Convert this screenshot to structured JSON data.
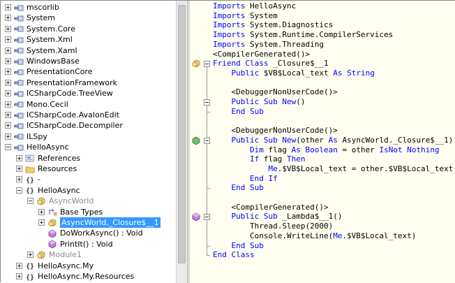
{
  "tree": {
    "items": [
      {
        "label": "mscorlib",
        "toggle": "plus",
        "icon": "assembly-icon"
      },
      {
        "label": "System",
        "toggle": "plus",
        "icon": "assembly-icon"
      },
      {
        "label": "System.Core",
        "toggle": "plus",
        "icon": "assembly-icon"
      },
      {
        "label": "System.Xml",
        "toggle": "plus",
        "icon": "assembly-icon"
      },
      {
        "label": "System.Xaml",
        "toggle": "plus",
        "icon": "assembly-icon"
      },
      {
        "label": "WindowsBase",
        "toggle": "plus",
        "icon": "assembly-icon"
      },
      {
        "label": "PresentationCore",
        "toggle": "plus",
        "icon": "assembly-icon"
      },
      {
        "label": "PresentationFramework",
        "toggle": "plus",
        "icon": "assembly-icon"
      },
      {
        "label": "ICSharpCode.TreeView",
        "toggle": "plus",
        "icon": "assembly-icon"
      },
      {
        "label": "Mono.Cecil",
        "toggle": "plus",
        "icon": "assembly-icon"
      },
      {
        "label": "ICSharpCode.AvalonEdit",
        "toggle": "plus",
        "icon": "assembly-icon"
      },
      {
        "label": "ICSharpCode.Decompiler",
        "toggle": "plus",
        "icon": "assembly-icon"
      },
      {
        "label": "ILSpy",
        "toggle": "plus",
        "icon": "assembly-icon"
      },
      {
        "label": "HelloAsync",
        "toggle": "minus",
        "icon": "assembly-icon"
      },
      {
        "label": "References",
        "toggle": "plus",
        "icon": "references-icon"
      },
      {
        "label": "Resources",
        "toggle": "plus",
        "icon": "folder-icon"
      },
      {
        "label": "-",
        "toggle": "plus",
        "icon": "namespace-icon"
      },
      {
        "label": "HelloAsync",
        "toggle": "minus",
        "icon": "namespace-icon"
      },
      {
        "label": "AsyncWorld",
        "toggle": "minus",
        "icon": "class-icon",
        "gray": true
      },
      {
        "label": "Base Types",
        "toggle": "plus",
        "icon": "base-types-icon"
      },
      {
        "label": "AsyncWorld._Closure$__1",
        "toggle": "plus",
        "icon": "class-icon",
        "selected": true
      },
      {
        "label": "DoWorkAsync() : Void",
        "toggle": "none",
        "icon": "method-icon"
      },
      {
        "label": "PrintIt() : Void",
        "toggle": "none",
        "icon": "method-icon"
      },
      {
        "label": "Module1",
        "toggle": "plus",
        "icon": "class-icon",
        "gray": true
      },
      {
        "label": "HelloAsync.My",
        "toggle": "plus",
        "icon": "namespace-icon"
      },
      {
        "label": "HelloAsync.My.Resources",
        "toggle": "plus",
        "icon": "namespace-icon"
      }
    ]
  },
  "code": {
    "lines": [
      [
        {
          "t": "Imports",
          "k": 1
        },
        {
          "t": " HelloAsync"
        }
      ],
      [
        {
          "t": "Imports",
          "k": 1
        },
        {
          "t": " System"
        }
      ],
      [
        {
          "t": "Imports",
          "k": 1
        },
        {
          "t": " System.Diagnostics"
        }
      ],
      [
        {
          "t": "Imports",
          "k": 1
        },
        {
          "t": " System.Runtime.CompilerServices"
        }
      ],
      [
        {
          "t": "Imports",
          "k": 1
        },
        {
          "t": " System.Threading"
        }
      ],
      [
        {
          "t": "<CompilerGenerated()>"
        }
      ],
      [
        {
          "t": "Friend",
          "k": 1
        },
        {
          "t": " "
        },
        {
          "t": "Class",
          "k": 1
        },
        {
          "t": " _Closure$__1"
        }
      ],
      [
        {
          "t": "    "
        },
        {
          "t": "Public",
          "k": 1
        },
        {
          "t": " $VB$Local_text "
        },
        {
          "t": "As",
          "k": 1
        },
        {
          "t": " "
        },
        {
          "t": "String",
          "k": 1
        }
      ],
      [
        {
          "t": ""
        }
      ],
      [
        {
          "t": "    <DebuggerNonUserCode()>"
        }
      ],
      [
        {
          "t": "    "
        },
        {
          "t": "Public",
          "k": 1
        },
        {
          "t": " "
        },
        {
          "t": "Sub",
          "k": 1
        },
        {
          "t": " "
        },
        {
          "t": "New",
          "k": 1
        },
        {
          "t": "()"
        }
      ],
      [
        {
          "t": "    "
        },
        {
          "t": "End",
          "k": 1
        },
        {
          "t": " "
        },
        {
          "t": "Sub",
          "k": 1
        }
      ],
      [
        {
          "t": ""
        }
      ],
      [
        {
          "t": "    <DebuggerNonUserCode()>"
        }
      ],
      [
        {
          "t": "    "
        },
        {
          "t": "Public",
          "k": 1
        },
        {
          "t": " "
        },
        {
          "t": "Sub",
          "k": 1
        },
        {
          "t": " "
        },
        {
          "t": "New",
          "k": 1
        },
        {
          "t": "(other "
        },
        {
          "t": "As",
          "k": 1
        },
        {
          "t": " AsyncWorld._Closure$__1)"
        }
      ],
      [
        {
          "t": "        "
        },
        {
          "t": "Dim",
          "k": 1
        },
        {
          "t": " flag "
        },
        {
          "t": "As",
          "k": 1
        },
        {
          "t": " "
        },
        {
          "t": "Boolean",
          "k": 1
        },
        {
          "t": " = other "
        },
        {
          "t": "IsNot",
          "k": 1
        },
        {
          "t": " "
        },
        {
          "t": "Nothing",
          "k": 1
        }
      ],
      [
        {
          "t": "        "
        },
        {
          "t": "If",
          "k": 1
        },
        {
          "t": " flag "
        },
        {
          "t": "Then",
          "k": 1
        }
      ],
      [
        {
          "t": "            "
        },
        {
          "t": "Me",
          "k": 1
        },
        {
          "t": ".$VB$Local_text = other.$VB$Local_text"
        }
      ],
      [
        {
          "t": "        "
        },
        {
          "t": "End",
          "k": 1
        },
        {
          "t": " "
        },
        {
          "t": "If",
          "k": 1
        }
      ],
      [
        {
          "t": "    "
        },
        {
          "t": "End",
          "k": 1
        },
        {
          "t": " "
        },
        {
          "t": "Sub",
          "k": 1
        }
      ],
      [
        {
          "t": ""
        }
      ],
      [
        {
          "t": "    <CompilerGenerated()>"
        }
      ],
      [
        {
          "t": "    "
        },
        {
          "t": "Public",
          "k": 1
        },
        {
          "t": " "
        },
        {
          "t": "Sub",
          "k": 1
        },
        {
          "t": " _Lambda$__1()"
        }
      ],
      [
        {
          "t": "        Thread.Sleep(2000)"
        }
      ],
      [
        {
          "t": "        Console.WriteLine("
        },
        {
          "t": "Me",
          "k": 1
        },
        {
          "t": ".$VB$Local_text)"
        }
      ],
      [
        {
          "t": "    "
        },
        {
          "t": "End",
          "k": 1
        },
        {
          "t": " "
        },
        {
          "t": "Sub",
          "k": 1
        }
      ],
      [
        {
          "t": "End",
          "k": 1
        },
        {
          "t": " "
        },
        {
          "t": "Class",
          "k": 1
        }
      ]
    ]
  },
  "colors": {
    "keyword": "#0000ff",
    "selection": "#3399ff",
    "code_bg": "#fffef0"
  }
}
